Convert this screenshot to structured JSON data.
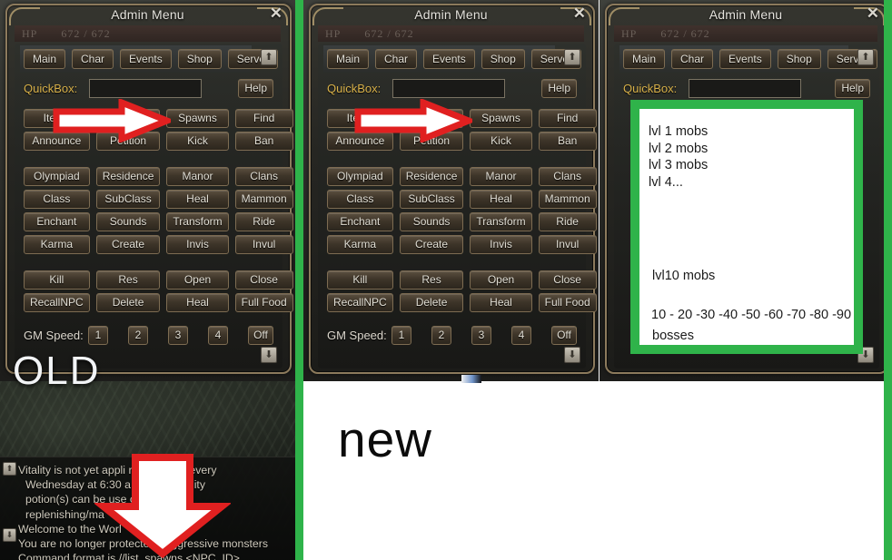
{
  "window": {
    "title": "Admin Menu",
    "close_label": "✕",
    "hp_label": "HP",
    "hp_value": "672 / 672"
  },
  "tabs": [
    {
      "label": "Main"
    },
    {
      "label": "Char"
    },
    {
      "label": "Events"
    },
    {
      "label": "Shop"
    },
    {
      "label": "Server"
    }
  ],
  "quickbox": {
    "label": "QuickBox:",
    "value": "",
    "placeholder": "",
    "help_label": "Help"
  },
  "buttons": {
    "group1": [
      "Items",
      "",
      "Spawns",
      "Find",
      "Announce",
      "Petition",
      "Kick",
      "Ban"
    ],
    "group2": [
      "Olympiad",
      "Residence",
      "Manor",
      "Clans",
      "Class",
      "SubClass",
      "Heal",
      "Mammon",
      "Enchant",
      "Sounds",
      "Transform",
      "Ride",
      "Karma",
      "Create",
      "Invis",
      "Invul"
    ],
    "group3": [
      "Kill",
      "Res",
      "Open",
      "Close",
      "RecallNPC",
      "Delete",
      "Heal",
      "Full Food"
    ]
  },
  "gm_speed": {
    "label": "GM Speed:",
    "options": [
      "1",
      "2",
      "3",
      "4",
      "Off"
    ]
  },
  "scroll": {
    "up_glyph": "⬆",
    "down_glyph": "⬇"
  },
  "annotations": {
    "old_label": "OLD",
    "new_label": "new",
    "arrow_color": "#e02020",
    "arrow_fill": "#ffffff",
    "divider_color": "#2fb34a"
  },
  "chat": {
    "lines": [
      "Vitality is not yet appli                 replenished every",
      "Wednesday at 6:30 a                  um of 5 vitality",
      "potion(s) can be use                 cluding",
      "replenishing/ma",
      "Welcome to the Worl",
      "You are no longer protecte      m aggressive monsters",
      "Command format is //list_spawns <NPC_ID>"
    ]
  },
  "spawn_list": {
    "lines": [
      "lvl 1 mobs",
      "lvl 2 mobs",
      "lvl 3 mobs",
      "lvl 4..."
    ],
    "mid_line": "lvl10 mobs",
    "range_head": "10 - 20 -30 -40 -50 -60 -70 -80 -90 -",
    "range_tail": "bosses",
    "clipped_line": "bosses"
  }
}
